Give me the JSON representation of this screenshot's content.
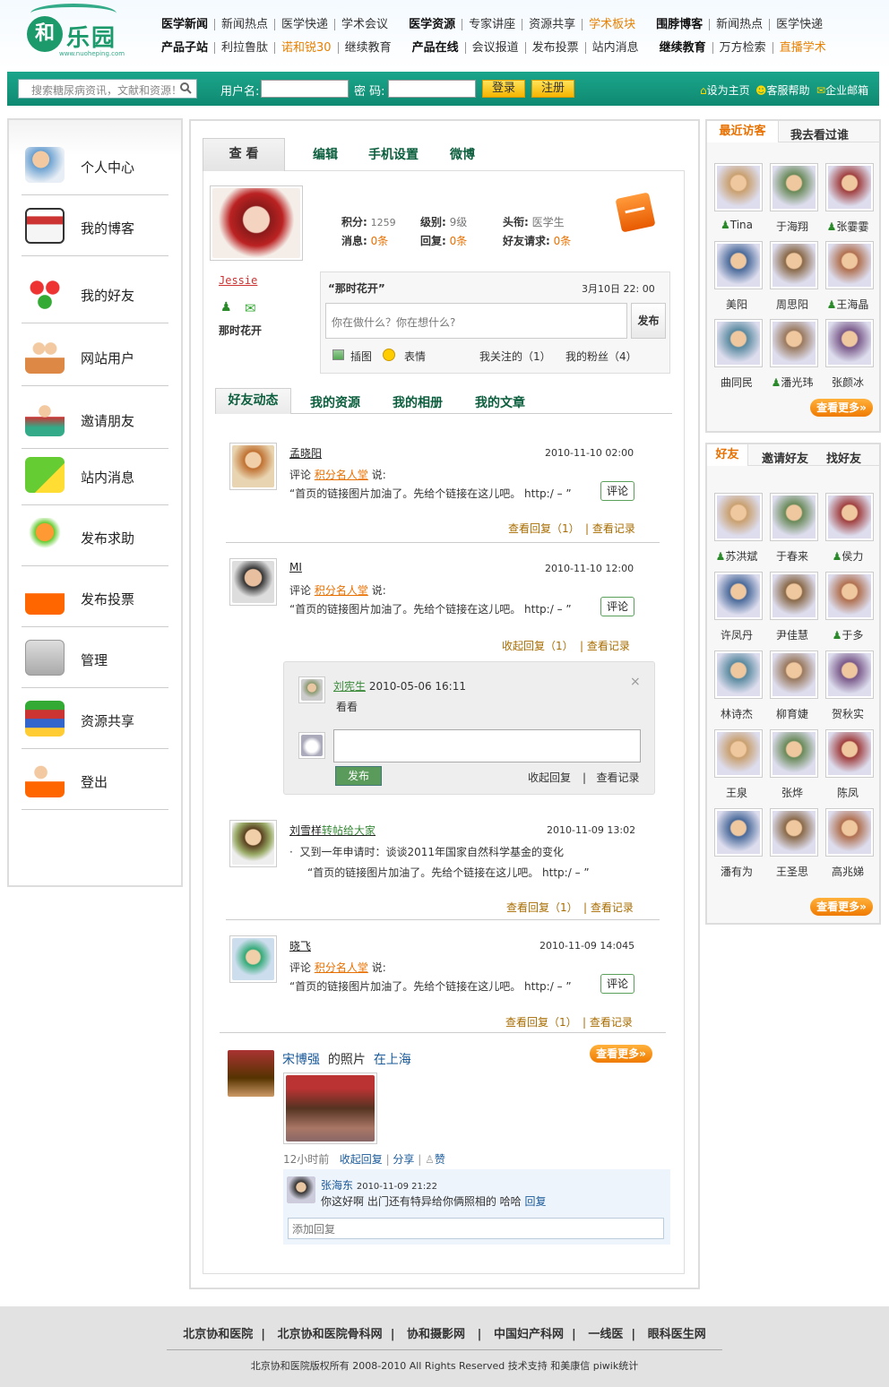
{
  "logo": {
    "name": "和乐园",
    "url": "www.nuoheping.com"
  },
  "topnav": {
    "row1": [
      "医学新闻",
      "新闻热点",
      "医学快递",
      "学术会议",
      "医学资源",
      "专家讲座",
      "资源共享",
      "学术板块",
      "围脖博客",
      "新闻热点",
      "医学快递"
    ],
    "row2": [
      "产品子站",
      "利拉鲁肽",
      "诺和锐30",
      "继续教育",
      "产品在线",
      "会议报道",
      "发布投票",
      "站内消息",
      "继续教育",
      "万方检索",
      "直播学术"
    ]
  },
  "bar": {
    "search_placeholder": "搜索糖尿病资讯，文献和资源！",
    "username_label": "用户名:",
    "password_label": "密 码:",
    "login": "登录",
    "register": "注册",
    "set_home": "设为主页",
    "help": "客服帮助",
    "mail": "企业邮箱"
  },
  "leftnav": [
    "个人中心",
    "我的博客",
    "我的好友",
    "网站用户",
    "邀请朋友",
    "站内消息",
    "发布求助",
    "发布投票",
    "管理",
    "资源共享",
    "登出"
  ],
  "tabs": [
    "查 看",
    "编辑",
    "手机设置",
    "微博"
  ],
  "profile": {
    "name": "Jessie",
    "motto": "那时花开",
    "points_label": "积分:",
    "points": "1259",
    "level_label": "级别:",
    "level": "9级",
    "title_label": "头衔:",
    "title": "医学生",
    "msg_label": "消息:",
    "msg": "0条",
    "reply_label": "回复:",
    "reply": "0条",
    "friend_req_label": "好友请求:",
    "friend_req": "0条"
  },
  "status": {
    "quote": "“那时花开”",
    "time": "3月10日  22: 00",
    "placeholder": "你在做什么？你在想什么?",
    "publish": "发布",
    "insert_image": "插图",
    "emoji": "表情",
    "following": "我关注的（1）",
    "fans": "我的粉丝（4）"
  },
  "subtabs": [
    "好友动态",
    "我的资源",
    "我的相册",
    "我的文章"
  ],
  "feed": [
    {
      "name": "孟晓阳",
      "date": "2010-11-10 02:00",
      "action_prefix": "评论",
      "target": "积分名人堂",
      "action_suffix": "说:",
      "text": "“首页的链接图片加油了。先给个链接在这儿吧。 http:/ – ”",
      "comment": "评论",
      "link1": "查看回复（1）",
      "link2": "查看记录"
    },
    {
      "name": "MI",
      "date": "2010-11-10 12:00",
      "action_prefix": "评论",
      "target": "积分名人堂",
      "action_suffix": "说:",
      "text": "“首页的链接图片加油了。先给个链接在这儿吧。 http:/ – ”",
      "comment": "评论",
      "link1": "收起回复（1）",
      "link2": "查看记录"
    },
    {
      "name": "刘雪样",
      "forward": "转帖给大家",
      "date": "2010-11-09 13:02",
      "line1": "又到一年申请时：谈谈2011年国家自然科学基金的变化",
      "text": "“首页的链接图片加油了。先给个链接在这儿吧。 http:/ – ”",
      "link1": "查看回复（1）",
      "link2": "查看记录"
    },
    {
      "name": "晓飞",
      "date": "2010-11-09 14:045",
      "action_prefix": "评论",
      "target": "积分名人堂",
      "action_suffix": "说:",
      "text": "“首页的链接图片加油了。先给个链接在这儿吧。 http:/ – ”",
      "comment": "评论",
      "link1": "查看回复（1）",
      "link2": "查看记录"
    }
  ],
  "reply_box": {
    "author": "刘宪生",
    "time": "2010-05-06 16:11",
    "text": "看看",
    "close": "×",
    "publish": "发布",
    "collapse": "收起回复",
    "record": "查看记录"
  },
  "photo_post": {
    "name": "宋博强",
    "mid": "的照片",
    "place": "在上海",
    "more": "查看更多»",
    "ago": "12小时前",
    "collapse": "收起回复",
    "share": "分享",
    "like": "赞",
    "reply_author": "张海东",
    "reply_time": "2010-11-09 21:22",
    "reply_text": "你这好啊  出门还有特异给你俩照相的  哈哈",
    "reply_link": "回复",
    "add_reply": "添加回复"
  },
  "visitors": {
    "tab_on": "最近访客",
    "tab_off": "我去看过谁",
    "names": [
      "Tina",
      "于海翔",
      "张霎霎",
      "美阳",
      "周思阳",
      "王海晶",
      "曲同民",
      "潘光玮",
      "张颜冰"
    ],
    "more": "查看更多»"
  },
  "friends": {
    "tab_on": "好友",
    "tab2": "邀请好友",
    "tab3": "找好友",
    "names": [
      "苏洪斌",
      "于春来",
      "侯力",
      "许凤丹",
      "尹佳慧",
      "于多",
      "林诗杰",
      "柳育婕",
      "贺秋实",
      "王泉",
      "张烨",
      "陈凤",
      "潘有为",
      "王圣思",
      "高兆娣"
    ],
    "more": "查看更多»"
  },
  "footer": {
    "links": [
      "北京协和医院",
      "北京协和医院骨科网",
      "协和摄影网",
      "中国妇产科网",
      "一线医",
      "眼科医生网"
    ],
    "copyright": "北京协和医院版权所有   2008-2010 All Rights Reserved 技术支持 和美康信  piwik统计"
  },
  "colors": {
    "green": "#1aa58a",
    "orange": "#e87000",
    "link_green": "#0b5e3d"
  }
}
